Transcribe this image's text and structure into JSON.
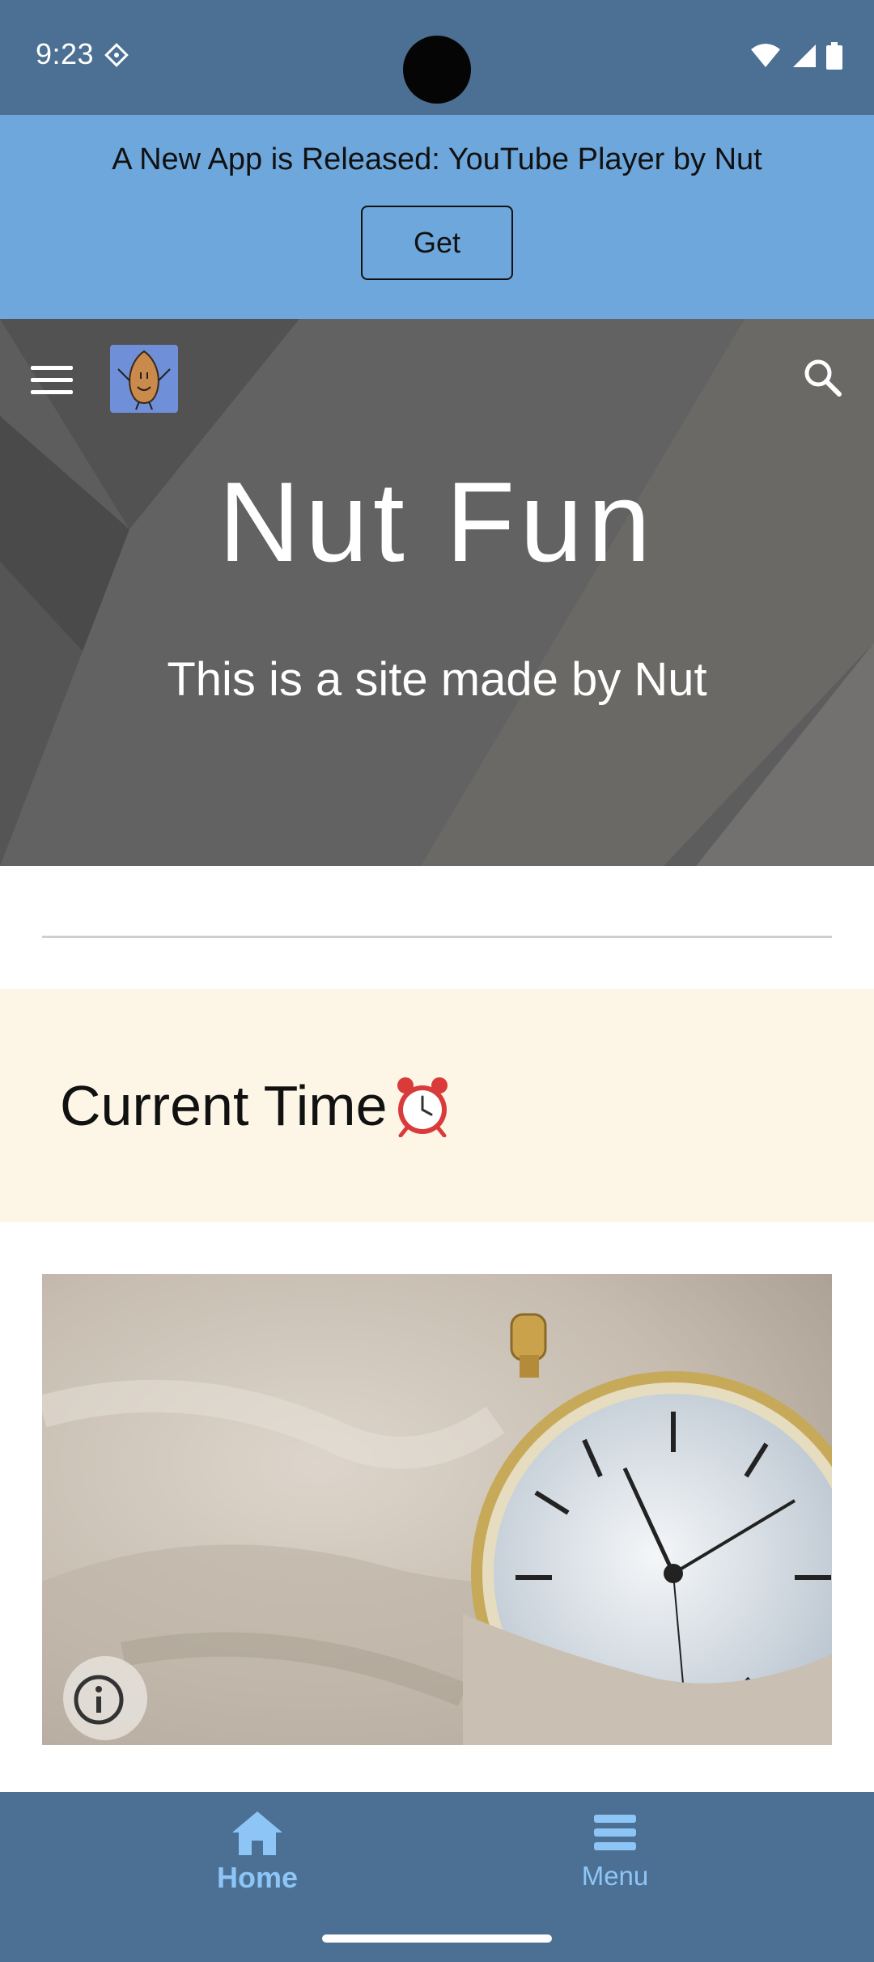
{
  "status_bar": {
    "time": "9:23",
    "icons": [
      "diamond-icon",
      "wifi-icon",
      "signal-icon",
      "battery-icon"
    ]
  },
  "banner": {
    "text": "A New App is Released: YouTube Player by Nut",
    "button_label": "Get",
    "background": "#6ea7dc"
  },
  "header": {
    "icons": [
      "hamburger-menu-icon",
      "nut-logo",
      "search-icon"
    ],
    "title": "Nut Fun",
    "subtitle": "This is a site made by Nut"
  },
  "section": {
    "title": "Current Time",
    "title_icon": "alarm-clock-icon",
    "background": "#fdf6e6"
  },
  "photo": {
    "subject": "pocket-watch-in-sand",
    "info_icon": "info-icon"
  },
  "bottom_nav": {
    "items": [
      {
        "label": "Home",
        "icon": "home-icon",
        "active": true
      },
      {
        "label": "Menu",
        "icon": "menu-icon",
        "active": false
      }
    ],
    "accent": "#8ec5f7",
    "background": "#4b7093"
  }
}
